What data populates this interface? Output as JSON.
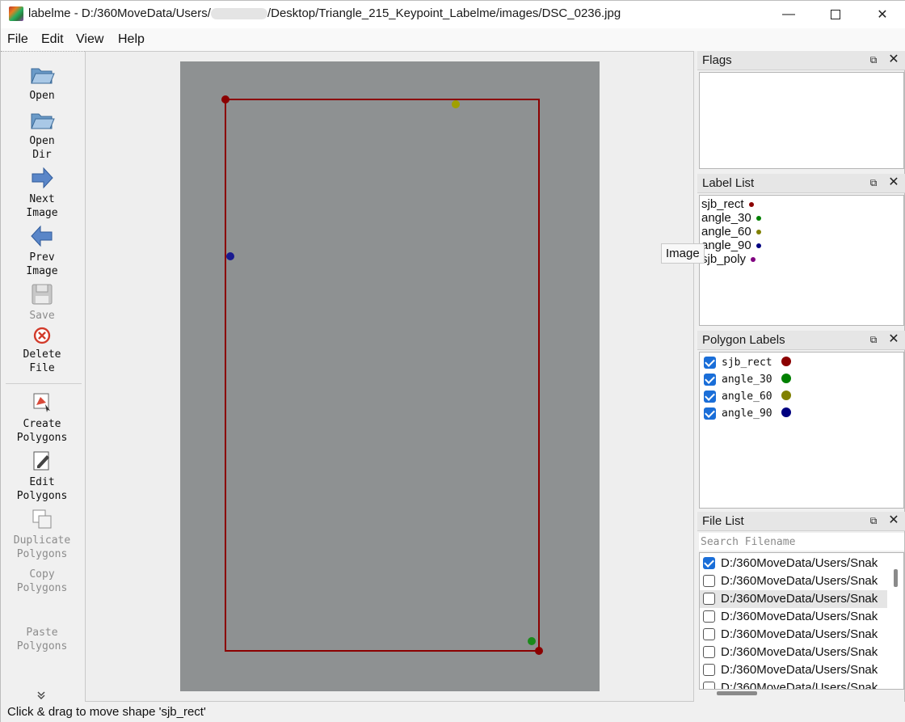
{
  "window": {
    "title": "labelme - D:/360MoveData/Users/",
    "title_tail": "/Desktop/Triangle_215_Keypoint_Labelme/images/DSC_0236.jpg",
    "controls": {
      "minimize": "—",
      "close": "✕"
    }
  },
  "menu": [
    "File",
    "Edit",
    "View",
    "Help"
  ],
  "toolbar": {
    "open": "Open",
    "open_dir": "Open\nDir",
    "next_image": "Next\nImage",
    "prev_image": "Prev\nImage",
    "save": "Save",
    "delete_file": "Delete\nFile",
    "create_polygons": "Create\nPolygons",
    "edit_polygons": "Edit\nPolygons",
    "duplicate_polygons": "Duplicate\nPolygons",
    "copy_polygons": "Copy\nPolygons",
    "paste_polygons": "Paste\nPolygons",
    "more": "»"
  },
  "docks": {
    "flags": {
      "title": "Flags"
    },
    "label_list": {
      "title": "Label List",
      "items": [
        {
          "label": "sjb_rect",
          "color": "#8b0000"
        },
        {
          "label": "angle_30",
          "color": "#008000"
        },
        {
          "label": "angle_60",
          "color": "#808000"
        },
        {
          "label": "angle_90",
          "color": "#000080"
        },
        {
          "label": "sjb_poly",
          "color": "#800080"
        }
      ]
    },
    "polygon_labels": {
      "title": "Polygon Labels",
      "items": [
        {
          "label": "sjb_rect",
          "checked": true,
          "color": "#8b0000"
        },
        {
          "label": "angle_30",
          "checked": true,
          "color": "#008000"
        },
        {
          "label": "angle_60",
          "checked": true,
          "color": "#808000"
        },
        {
          "label": "angle_90",
          "checked": true,
          "color": "#000080"
        }
      ]
    },
    "file_list": {
      "title": "File List",
      "search_placeholder": "Search Filename",
      "files": [
        {
          "path": "D:/360MoveData/Users/Snak",
          "checked": true
        },
        {
          "path": "D:/360MoveData/Users/Snak",
          "checked": false
        },
        {
          "path": "D:/360MoveData/Users/Snak",
          "checked": false
        },
        {
          "path": "D:/360MoveData/Users/Snak",
          "checked": false
        },
        {
          "path": "D:/360MoveData/Users/Snak",
          "checked": false
        },
        {
          "path": "D:/360MoveData/Users/Snak",
          "checked": false
        },
        {
          "path": "D:/360MoveData/Users/Snak",
          "checked": false
        },
        {
          "path": "D:/360MoveData/Users/Snak",
          "checked": false
        }
      ]
    }
  },
  "tooltip": "Image",
  "status": "Click & drag to move shape 'sjb_rect'",
  "icons": {
    "float": "⧉",
    "close": "✕"
  }
}
